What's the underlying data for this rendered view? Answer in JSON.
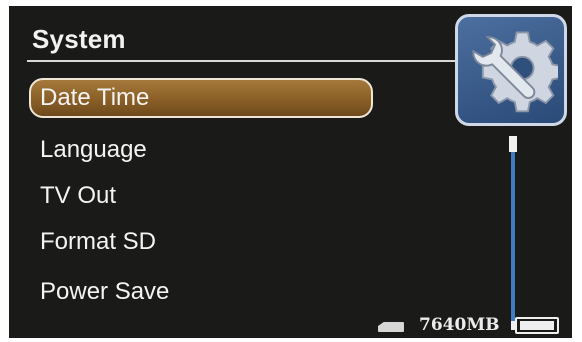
{
  "header": {
    "title": "System"
  },
  "menu": {
    "items": [
      {
        "label": "Date Time",
        "selected": true
      },
      {
        "label": "Language",
        "selected": false
      },
      {
        "label": "TV Out",
        "selected": false
      },
      {
        "label": "Format SD",
        "selected": false
      },
      {
        "label": "Power Save",
        "selected": false
      }
    ]
  },
  "status": {
    "storage": "7640MB",
    "battery_level": 1.0,
    "sd_icon": "sd-card-icon",
    "battery_icon": "battery-icon"
  },
  "icons": {
    "settings": "gear-wrench-icon"
  },
  "scroll": {
    "position": 0.0
  },
  "colors": {
    "background": "#1a1a18",
    "selection": "#8a5f27",
    "accent": "#3e7bc4",
    "text": "#f4f4f4"
  }
}
